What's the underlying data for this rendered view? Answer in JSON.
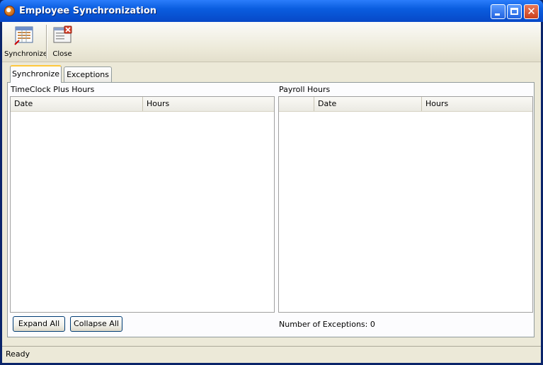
{
  "window": {
    "title": "Employee Synchronization"
  },
  "toolbar": {
    "synchronize_label": "Synchronize",
    "close_label": "Close"
  },
  "tabs": [
    {
      "label": "Synchronize",
      "active": true
    },
    {
      "label": "Exceptions",
      "active": false
    }
  ],
  "left_panel": {
    "title": "TimeClock Plus Hours",
    "columns": [
      "Date",
      "Hours"
    ],
    "rows": []
  },
  "right_panel": {
    "title": "Payroll Hours",
    "columns": [
      "",
      "Date",
      "Hours"
    ],
    "rows": []
  },
  "buttons": {
    "expand_all": "Expand All",
    "collapse_all": "Collapse All"
  },
  "exceptions": {
    "text": "Number of Exceptions: 0"
  },
  "status": {
    "text": "Ready"
  },
  "colors": {
    "title_bar": "#0a5ddf",
    "client_bg": "#ece9d8",
    "active_tab_accent": "#ffc83c"
  }
}
